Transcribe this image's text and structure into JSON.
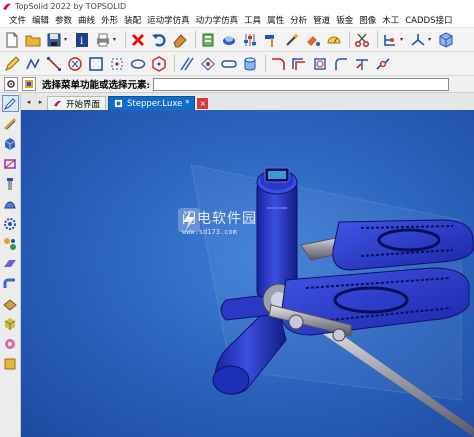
{
  "window": {
    "title": "TopSolid 2022 by TOPSOLID"
  },
  "menu": [
    "文件",
    "编辑",
    "参数",
    "曲线",
    "外形",
    "装配",
    "运动学仿真",
    "动力学仿真",
    "工具",
    "属性",
    "分析",
    "管道",
    "钣金",
    "图像",
    "木工",
    "CADDS接口"
  ],
  "toolbar1": {
    "icons": [
      "new-file-icon",
      "open-folder-icon",
      "save-icon",
      "info-icon",
      "print-icon",
      "delete-icon",
      "undo-icon",
      "eraser-icon",
      "layers-icon",
      "render-icon",
      "sliders-icon",
      "hammer-icon",
      "wand-icon",
      "paint-icon",
      "gauge-icon",
      "scissors-icon",
      "tree-icon",
      "axes-icon",
      "cube-view-icon"
    ]
  },
  "toolbar2": {
    "icons": [
      "pencil-icon",
      "polyline-icon",
      "line-icon",
      "circle-x-icon",
      "square-icon",
      "point-grid-icon",
      "ellipse-icon",
      "hexagon-icon",
      "slash-icon",
      "diamond-point-icon",
      "slot-icon",
      "cylinder-icon",
      "arc-icon",
      "offset-icon",
      "hex-bolt-icon",
      "fillet-icon",
      "trim-icon",
      "chain-icon"
    ]
  },
  "command": {
    "prompt": "选择菜单功能或选择元素:",
    "value": ""
  },
  "tabs": [
    {
      "label": "开始界面",
      "active": false
    },
    {
      "label": "Stepper.Luxe *",
      "active": true
    }
  ],
  "watermark": {
    "title": "闪电软件园",
    "url": "www.sd173.com"
  },
  "colors": {
    "viewport": "#2b63bd",
    "active_tab": "#0f6cc9",
    "model_blue": "#1e2fb8"
  }
}
